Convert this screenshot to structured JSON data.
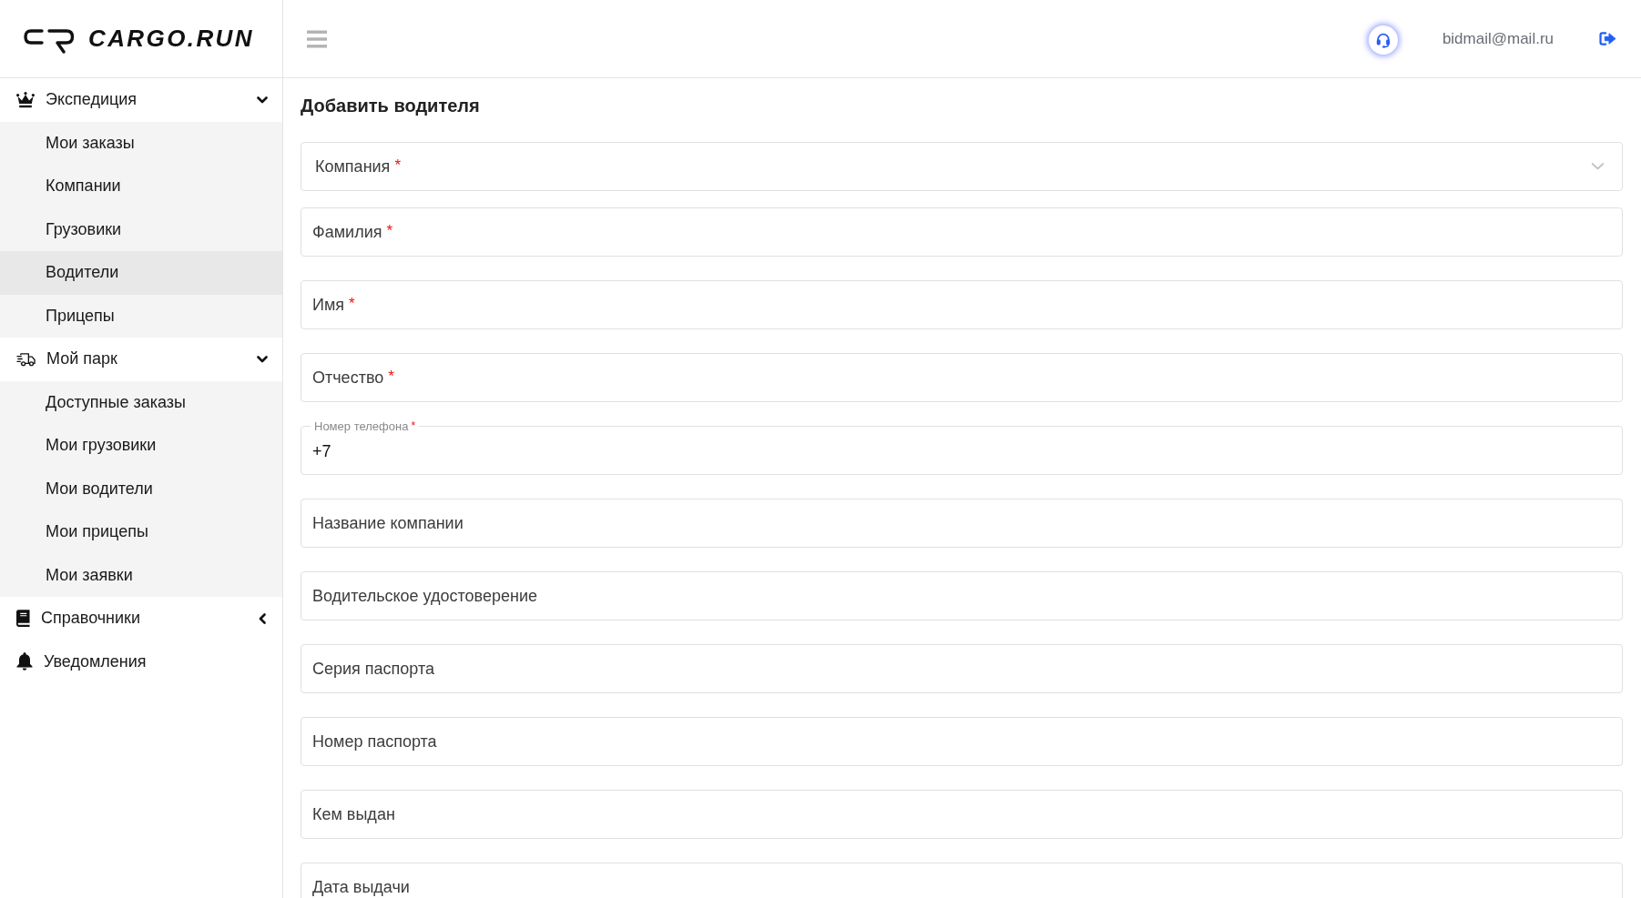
{
  "brand": {
    "name": "CARGO.RUN"
  },
  "header": {
    "user_email": "bidmail@mail.ru"
  },
  "sidebar": {
    "items": [
      {
        "label": "Экспедиция",
        "expanded": true,
        "children": [
          {
            "label": "Мои заказы",
            "selected": false
          },
          {
            "label": "Компании",
            "selected": false
          },
          {
            "label": "Грузовики",
            "selected": false
          },
          {
            "label": "Водители",
            "selected": true
          },
          {
            "label": "Прицепы",
            "selected": false
          }
        ]
      },
      {
        "label": "Мой парк",
        "expanded": true,
        "children": [
          {
            "label": "Доступные заказы",
            "selected": false
          },
          {
            "label": "Мои грузовики",
            "selected": false
          },
          {
            "label": "Мои водители",
            "selected": false
          },
          {
            "label": "Мои прицепы",
            "selected": false
          },
          {
            "label": "Мои заявки",
            "selected": false
          }
        ]
      },
      {
        "label": "Справочники",
        "expanded": false
      },
      {
        "label": "Уведомления"
      }
    ]
  },
  "form": {
    "title": "Добавить водителя",
    "fields": [
      {
        "kind": "select",
        "placeholder": "Компания",
        "required_mark": "*"
      },
      {
        "kind": "text",
        "placeholder": "Фамилия",
        "required_mark": "*"
      },
      {
        "kind": "text",
        "placeholder": "Имя",
        "required_mark": "*"
      },
      {
        "kind": "text",
        "placeholder": "Отчество",
        "required_mark": "*"
      },
      {
        "kind": "labeled",
        "label": "Номер телефона",
        "required_mark": "*",
        "value": "+7"
      },
      {
        "kind": "text",
        "placeholder": "Название компании"
      },
      {
        "kind": "text",
        "placeholder": "Водительское удостоверение"
      },
      {
        "kind": "text",
        "placeholder": "Серия паспорта"
      },
      {
        "kind": "text",
        "placeholder": "Номер паспорта"
      },
      {
        "kind": "text",
        "placeholder": "Кем выдан"
      },
      {
        "kind": "text",
        "placeholder": "Дата выдачи"
      }
    ]
  }
}
